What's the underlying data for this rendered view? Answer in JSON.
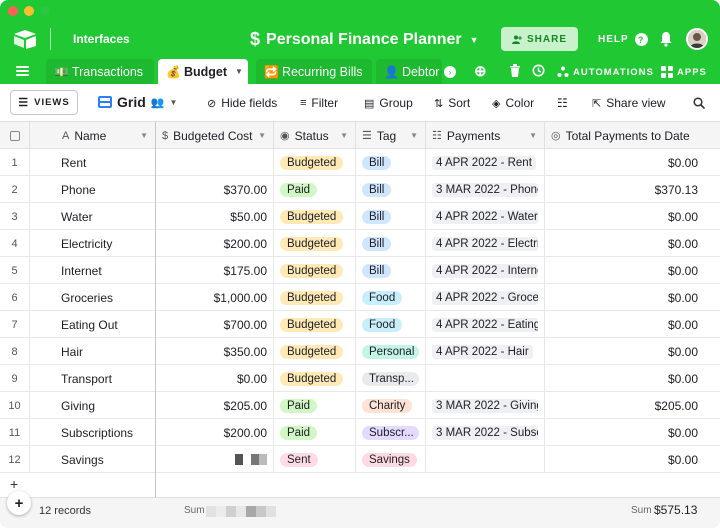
{
  "app": {
    "interfaces_label": "Interfaces",
    "base_title": "Personal Finance Planner",
    "base_icon": "$",
    "share_label": "SHARE",
    "help_label": "HELP",
    "help_icon": "?"
  },
  "tabs": [
    {
      "emoji": "💵",
      "label": "Transactions",
      "active": false
    },
    {
      "emoji": "💰",
      "label": "Budget",
      "active": true
    },
    {
      "emoji": "🔁",
      "label": "Recurring Bills",
      "active": false
    },
    {
      "emoji": "👤",
      "label": "Debtor",
      "active": false
    }
  ],
  "header_right": {
    "automations_label": "AUTOMATIONS",
    "apps_label": "APPS"
  },
  "toolbar": {
    "views_label": "VIEWS",
    "grid_label": "Grid",
    "hide_fields": "Hide fields",
    "filter": "Filter",
    "group": "Group",
    "sort": "Sort",
    "color": "Color",
    "share_view": "Share view"
  },
  "columns": {
    "name": "Name",
    "budgeted_cost": "Budgeted Cost",
    "status": "Status",
    "tag": "Tag",
    "payments": "Payments",
    "total_payments": "Total Payments to Date"
  },
  "colors": {
    "brand_green": "#20c933",
    "status_budgeted": "#ffeab6",
    "status_paid": "#d1f7c4",
    "status_sent": "#ffdce5",
    "tag_bill": "#d0e5fe",
    "tag_food": "#c8eefb",
    "tag_personal": "#c3f5e6",
    "tag_transport": "#e9eaec",
    "tag_charity": "#fee2d5",
    "tag_subscription": "#e4dafe",
    "tag_savings": "#ffdae3"
  },
  "rows": [
    {
      "n": "1",
      "name": "Rent",
      "cost": "",
      "status": "Budgeted",
      "tag": "Bill",
      "payment": "4 APR 2022 - Rent",
      "total": "$0.00"
    },
    {
      "n": "2",
      "name": "Phone",
      "cost": "$370.00",
      "status": "Paid",
      "tag": "Bill",
      "payment": "3 MAR 2022 - Phone",
      "total": "$370.13"
    },
    {
      "n": "3",
      "name": "Water",
      "cost": "$50.00",
      "status": "Budgeted",
      "tag": "Bill",
      "payment": "4 APR 2022 - Water",
      "total": "$0.00"
    },
    {
      "n": "4",
      "name": "Electricity",
      "cost": "$200.00",
      "status": "Budgeted",
      "tag": "Bill",
      "payment": "4 APR 2022 - Electric",
      "total": "$0.00"
    },
    {
      "n": "5",
      "name": "Internet",
      "cost": "$175.00",
      "status": "Budgeted",
      "tag": "Bill",
      "payment": "4 APR 2022 - Interne",
      "total": "$0.00"
    },
    {
      "n": "6",
      "name": "Groceries",
      "cost": "$1,000.00",
      "status": "Budgeted",
      "tag": "Food",
      "payment": "4 APR 2022 - Grocer",
      "total": "$0.00"
    },
    {
      "n": "7",
      "name": "Eating Out",
      "cost": "$700.00",
      "status": "Budgeted",
      "tag": "Food",
      "payment": "4 APR 2022 - Eating",
      "total": "$0.00"
    },
    {
      "n": "8",
      "name": "Hair",
      "cost": "$350.00",
      "status": "Budgeted",
      "tag": "Personal",
      "payment": "4 APR 2022 - Hair",
      "total": "$0.00"
    },
    {
      "n": "9",
      "name": "Transport",
      "cost": "$0.00",
      "status": "Budgeted",
      "tag": "Transp...",
      "payment": "",
      "total": "$0.00"
    },
    {
      "n": "10",
      "name": "Giving",
      "cost": "$205.00",
      "status": "Paid",
      "tag": "Charity",
      "payment": "3 MAR 2022 - Giving",
      "total": "$205.00"
    },
    {
      "n": "11",
      "name": "Subscriptions",
      "cost": "$200.00",
      "status": "Paid",
      "tag": "Subscr...",
      "payment": "3 MAR 2022 - Subscr",
      "total": "$0.00"
    },
    {
      "n": "12",
      "name": "Savings",
      "cost": "",
      "status": "Sent",
      "tag": "Savings",
      "payment": "",
      "total": "$0.00"
    }
  ],
  "footer": {
    "records": "12 records",
    "sum_label": "Sum",
    "total_sum": "$575.13"
  }
}
